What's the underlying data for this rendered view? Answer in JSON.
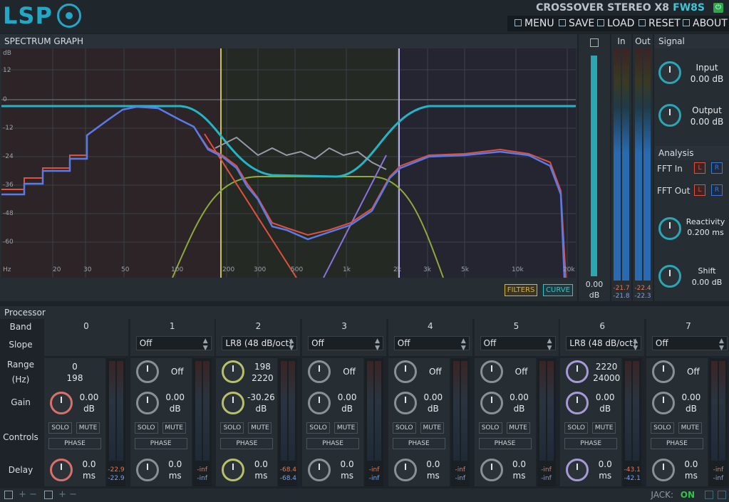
{
  "header": {
    "logo": "LSP",
    "plugin_title": "CROSSOVER STEREO X8",
    "fw_code": "FW8S",
    "menu": [
      "MENU",
      "SAVE",
      "LOAD",
      "RESET",
      "ABOUT"
    ]
  },
  "spectrum": {
    "title": "SPECTRUM GRAPH",
    "db_label": "dB",
    "y_ticks": [
      "12",
      "0",
      "-12",
      "-24",
      "-36",
      "-48",
      "-60"
    ],
    "x_ticks": [
      "Hz",
      "20",
      "30",
      "50",
      "100",
      "200",
      "300",
      "500",
      "1k",
      "2k",
      "3k",
      "5k",
      "10k",
      "20k"
    ],
    "filters_btn": "FILTERS",
    "curve_btn": "CURVE"
  },
  "zoom": {
    "value": "0.00",
    "unit": "dB"
  },
  "meters": {
    "in_label": "In",
    "out_label": "Out",
    "in_vals": [
      "-21.7",
      "-21.8"
    ],
    "out_vals": [
      "-22.4",
      "-22.3"
    ]
  },
  "signal": {
    "title": "Signal",
    "input_label": "Input",
    "input_value": "0.00 dB",
    "output_label": "Output",
    "output_value": "0.00 dB"
  },
  "analysis": {
    "title": "Analysis",
    "fft_in": "FFT In",
    "fft_out": "FFT Out",
    "l": "L",
    "r": "R",
    "reactivity_label": "Reactivity",
    "reactivity_value": "0.200 ms",
    "shift_label": "Shift",
    "shift_value": "0.00 dB"
  },
  "processor": {
    "title": "Processor",
    "row_labels": [
      "Band",
      "Slope",
      "Range",
      "(Hz)",
      "Gain",
      "Controls",
      "Delay"
    ],
    "solo": "SOLO",
    "mute": "MUTE",
    "phase": "PHASE",
    "db": "dB",
    "ms": "ms",
    "bands": [
      {
        "num": "0",
        "slope": "",
        "range1": "0",
        "range2": "198",
        "gain": "0.00",
        "delay": "0.0",
        "m1": "-22.9",
        "m2": "-22.9",
        "color": "#d9706a"
      },
      {
        "num": "1",
        "slope": "Off",
        "range1": "Off",
        "range2": "",
        "gain": "0.00",
        "delay": "0.0",
        "m1": "-inf",
        "m2": "-inf",
        "color": "#8a9196"
      },
      {
        "num": "2",
        "slope": "LR8 (48 dB/oct)",
        "range1": "198",
        "range2": "2220",
        "gain": "-30.26",
        "delay": "0.0",
        "m1": "-68.4",
        "m2": "-68.4",
        "color": "#b8c06a"
      },
      {
        "num": "3",
        "slope": "Off",
        "range1": "Off",
        "range2": "",
        "gain": "0.00",
        "delay": "0.0",
        "m1": "-inf",
        "m2": "-inf",
        "color": "#8a9196"
      },
      {
        "num": "4",
        "slope": "Off",
        "range1": "Off",
        "range2": "",
        "gain": "0.00",
        "delay": "0.0",
        "m1": "-inf",
        "m2": "-inf",
        "color": "#8a9196"
      },
      {
        "num": "5",
        "slope": "Off",
        "range1": "Off",
        "range2": "",
        "gain": "0.00",
        "delay": "0.0",
        "m1": "-inf",
        "m2": "-inf",
        "color": "#8a9196"
      },
      {
        "num": "6",
        "slope": "LR8 (48 dB/oct)",
        "range1": "2220",
        "range2": "24000",
        "gain": "0.00",
        "delay": "0.0",
        "m1": "-43.1",
        "m2": "-42.1",
        "color": "#a79ad6"
      },
      {
        "num": "7",
        "slope": "Off",
        "range1": "Off",
        "range2": "",
        "gain": "0.00",
        "delay": "0.0",
        "m1": "-inf",
        "m2": "-inf",
        "color": "#8a9196"
      }
    ]
  },
  "status": {
    "jack_label": "JACK:",
    "jack_state": "ON"
  },
  "colors": {
    "accent": "#22a7c6",
    "bg": "#1d2329",
    "panel": "#262d33"
  }
}
